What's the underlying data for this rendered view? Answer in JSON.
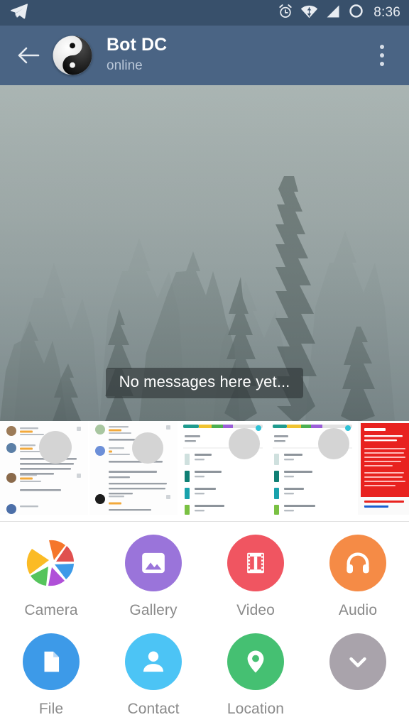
{
  "statusbar": {
    "app_icon": "telegram-send-icon",
    "icons": [
      "alarm-clock-icon",
      "wifi-icon",
      "cellular-signal-icon",
      "battery-circle-icon"
    ],
    "time": "8:36"
  },
  "appbar": {
    "back_icon": "back-arrow-icon",
    "avatar_icon": "yin-yang-avatar",
    "title": "Bot DC",
    "status": "online",
    "overflow_icon": "overflow-menu-icon"
  },
  "chat": {
    "wallpaper": "foggy-forest-wallpaper",
    "empty_text": "No messages here yet..."
  },
  "photo_strip": {
    "label": "recent-photos-strip",
    "thumbnails": [
      {
        "name": "thumb-app-reviews-1",
        "kind": "reviews"
      },
      {
        "name": "thumb-app-reviews-2",
        "kind": "reviews"
      },
      {
        "name": "thumb-storage-list-1",
        "kind": "storage"
      },
      {
        "name": "thumb-storage-list-2",
        "kind": "storage"
      },
      {
        "name": "thumb-warning-page",
        "kind": "warning",
        "heading": "WARNING!"
      }
    ]
  },
  "attach_menu": {
    "row1": [
      {
        "name": "camera",
        "label": "Camera",
        "icon": "camera-aperture-icon",
        "color": "#ffffff"
      },
      {
        "name": "gallery",
        "label": "Gallery",
        "icon": "image-icon",
        "color": "#9a74da"
      },
      {
        "name": "video",
        "label": "Video",
        "icon": "film-strip-icon",
        "color": "#f05561"
      },
      {
        "name": "audio",
        "label": "Audio",
        "icon": "headphones-icon",
        "color": "#f58b46"
      }
    ],
    "row2": [
      {
        "name": "file",
        "label": "File",
        "icon": "document-icon",
        "color": "#3d9ae8"
      },
      {
        "name": "contact",
        "label": "Contact",
        "icon": "person-icon",
        "color": "#4cc4f5"
      },
      {
        "name": "location",
        "label": "Location",
        "icon": "map-pin-icon",
        "color": "#45c072"
      },
      {
        "name": "collapse",
        "label": "",
        "icon": "chevron-down-icon",
        "color": "#a9a3ab"
      }
    ]
  },
  "colors": {
    "statusbar_bg": "#38506b",
    "appbar_bg": "#4a6484",
    "panel_bg": "#ffffff",
    "label_text": "#8a8a8a",
    "bubble_bg": "rgba(45,52,54,.62)"
  },
  "camera_blades": [
    "#f5762b",
    "#e0504f",
    "#3d9ae8",
    "#b050d8",
    "#56c45c",
    "#fbbb25"
  ]
}
